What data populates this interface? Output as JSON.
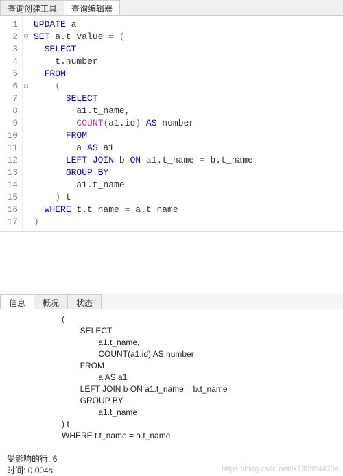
{
  "tabs": {
    "tool": "查询创建工具",
    "editor": "查询编辑器"
  },
  "gutter_fold": [
    "",
    "⊟",
    "",
    "",
    "",
    "⊟",
    "",
    "",
    "",
    "",
    "",
    "",
    "",
    "",
    "",
    "",
    ""
  ],
  "code_tokens": [
    [
      [
        "kw",
        "UPDATE"
      ],
      [
        "id",
        " a"
      ]
    ],
    [
      [
        "kw",
        "SET"
      ],
      [
        "id",
        " a.t_value "
      ],
      [
        "op",
        "="
      ],
      [
        "id",
        " "
      ],
      [
        "op",
        "("
      ]
    ],
    [
      [
        "id",
        "  "
      ],
      [
        "kw",
        "SELECT"
      ]
    ],
    [
      [
        "id",
        "    t.number"
      ]
    ],
    [
      [
        "id",
        "  "
      ],
      [
        "kw",
        "FROM"
      ]
    ],
    [
      [
        "id",
        "    "
      ],
      [
        "op",
        "("
      ]
    ],
    [
      [
        "id",
        "      "
      ],
      [
        "kw",
        "SELECT"
      ]
    ],
    [
      [
        "id",
        "        a1.t_name,"
      ]
    ],
    [
      [
        "id",
        "        "
      ],
      [
        "fn",
        "COUNT"
      ],
      [
        "op",
        "("
      ],
      [
        "id",
        "a1.id"
      ],
      [
        "op",
        ")"
      ],
      [
        "id",
        " "
      ],
      [
        "kw",
        "AS"
      ],
      [
        "id",
        " number"
      ]
    ],
    [
      [
        "id",
        "      "
      ],
      [
        "kw",
        "FROM"
      ]
    ],
    [
      [
        "id",
        "        a "
      ],
      [
        "kw",
        "AS"
      ],
      [
        "id",
        " a1"
      ]
    ],
    [
      [
        "id",
        "      "
      ],
      [
        "kw",
        "LEFT JOIN"
      ],
      [
        "id",
        " b "
      ],
      [
        "kw",
        "ON"
      ],
      [
        "id",
        " a1.t_name "
      ],
      [
        "op",
        "="
      ],
      [
        "id",
        " b.t_name"
      ]
    ],
    [
      [
        "id",
        "      "
      ],
      [
        "kw",
        "GROUP BY"
      ]
    ],
    [
      [
        "id",
        "        a1.t_name"
      ]
    ],
    [
      [
        "id",
        "    "
      ],
      [
        "op",
        ")"
      ],
      [
        "id",
        " t"
      ],
      [
        "cursor",
        ""
      ]
    ],
    [
      [
        "id",
        "  "
      ],
      [
        "kw",
        "WHERE"
      ],
      [
        "id",
        " t.t_name "
      ],
      [
        "op",
        "="
      ],
      [
        "id",
        " a.t_name"
      ]
    ],
    [
      [
        "op",
        ")"
      ]
    ]
  ],
  "result_tabs": {
    "info": "信息",
    "profile": "概况",
    "status": "状态"
  },
  "result_text": "(\n        SELECT\n                a1.t_name,\n                COUNT(a1.id) AS number\n        FROM\n                a AS a1\n        LEFT JOIN b ON a1.t_name = b.t_name\n        GROUP BY\n                a1.t_name\n) t\nWHERE t.t_name = a.t_name",
  "footer": {
    "affected_label": "受影响的行:",
    "affected_value": "6",
    "time_label": "时间:",
    "time_value": "0.004s"
  },
  "watermark": "https://blog.csdn.net/lx1309244704"
}
